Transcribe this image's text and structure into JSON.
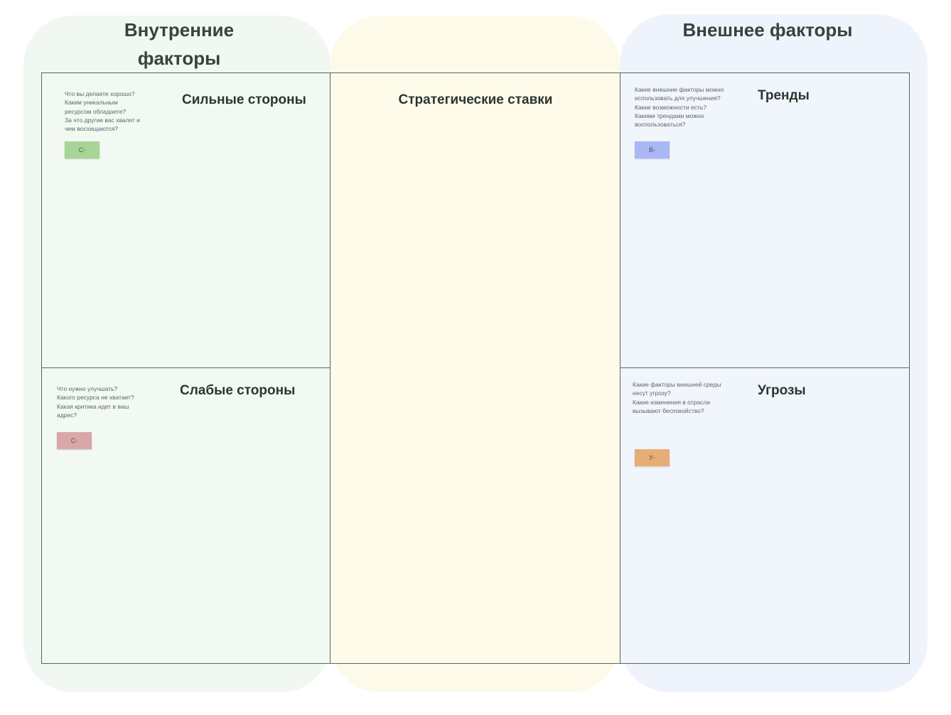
{
  "columns": {
    "internal": {
      "header": "Внутренние факторы"
    },
    "external": {
      "header": "Внешнее факторы"
    }
  },
  "quadrants": {
    "strengths": {
      "title": "Сильные стороны",
      "prompts": [
        "Что вы делаете хорошо?",
        "Каким уникальным",
        "ресурсом обладаете?",
        "За что другие вас хвалят и",
        "чем восхищаются?"
      ],
      "sticky": {
        "label": "С-",
        "color": "#a8d495"
      }
    },
    "weaknesses": {
      "title": "Слабые стороны",
      "prompts": [
        "Что нужно улучшать?",
        "Какого ресурса не хватает?",
        "Какая критика идет в ваш",
        "адрес?"
      ],
      "sticky": {
        "label": "С-",
        "color": "#d9a7a7"
      }
    },
    "strategy": {
      "title": "Стратегические ставки"
    },
    "trends": {
      "title": "Тренды",
      "prompts": [
        "Какие внешние факторы можно",
        "использовать для улучшения?",
        "Какие возможности есть?",
        "Какими трендами можно",
        "воспользоваться?"
      ],
      "sticky": {
        "label": "В-",
        "color": "#a9b7f5"
      }
    },
    "threats": {
      "title": "Угрозы",
      "prompts": [
        "Какие факторы внешней среды",
        "несут угрозу?",
        "Какие изменения в отрасли",
        "вызывают беспокойство?"
      ],
      "sticky": {
        "label": "У-",
        "color": "#e8ad74"
      }
    }
  }
}
